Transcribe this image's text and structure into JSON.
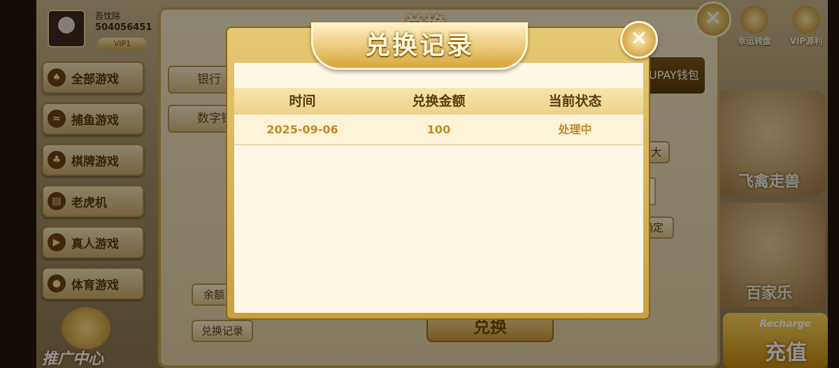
{
  "profile": {
    "name": "吾忱除",
    "id": "504056451",
    "vip": "VIP1"
  },
  "side_menu": [
    {
      "label": "全部游戏",
      "icon": "cards-icon"
    },
    {
      "label": "捕鱼游戏",
      "icon": "fish-icon"
    },
    {
      "label": "棋牌游戏",
      "icon": "chess-icon"
    },
    {
      "label": "老虎机",
      "icon": "slot-machine-icon"
    },
    {
      "label": "真人游戏",
      "icon": "play-icon"
    },
    {
      "label": "体育游戏",
      "icon": "soccer-ball-icon"
    }
  ],
  "promo": {
    "label": "推广中心"
  },
  "top_icons": [
    {
      "label": "幸运转盘"
    },
    {
      "label": "VIP源利"
    }
  ],
  "games": [
    {
      "label": "飞禽走兽"
    },
    {
      "label": "百家乐"
    }
  ],
  "recharge": {
    "en": "Recharge",
    "cn": "充值"
  },
  "exchange": {
    "title": "兑换",
    "tab_bank": "银行",
    "tab_digital": "数字钱",
    "tab_upay": "UPAY钱包",
    "btn_max": "最大",
    "btn_confirm": "确定",
    "btn_balance": "余额",
    "btn_records": "兑换记录",
    "submit": "兑换"
  },
  "modal": {
    "title": "兑换记录",
    "columns": [
      "时间",
      "兑换金额",
      "当前状态"
    ],
    "rows": [
      [
        "2025-09-06",
        "100",
        "处理中"
      ]
    ]
  },
  "colors": {
    "gold": "#c9a040",
    "text_brown": "#5b3a0d",
    "row_text": "#c08a2a"
  }
}
